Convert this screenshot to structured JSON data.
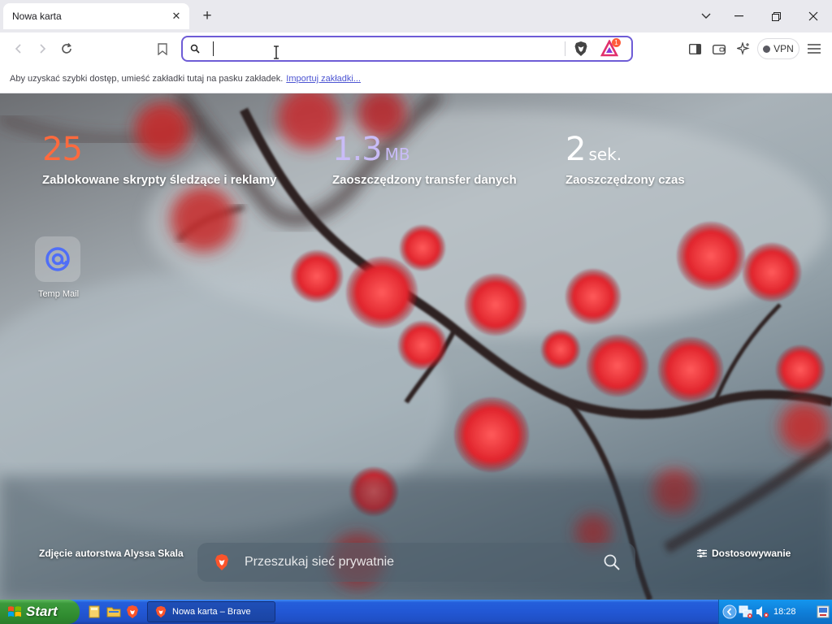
{
  "browser": {
    "tab_title": "Nowa karta",
    "address_value": "",
    "rewards_badge": "1",
    "vpn_label": "VPN"
  },
  "bookmarks_bar": {
    "text": "Aby uzyskać szybki dostęp, umieść zakładki tutaj na pasku zakładek.",
    "import_link": "Importuj zakładki..."
  },
  "stats": [
    {
      "value": "25",
      "unit": "",
      "label": "Zablokowane skrypty śledzące i reklamy",
      "color": "#ff6a3d"
    },
    {
      "value": "1.3",
      "unit": "MB",
      "label": "Zaoszczędzony transfer danych",
      "color": "#c9bcf7"
    },
    {
      "value": "2",
      "unit": "sek.",
      "label": "Zaoszczędzony czas",
      "color": "#ffffff"
    }
  ],
  "top_sites": [
    {
      "label": "Temp Mail"
    }
  ],
  "photo_credit": "Zdjęcie autorstwa Alyssa Skala",
  "search": {
    "placeholder": "Przeszukaj sieć prywatnie"
  },
  "customize_label": "Dostosowywanie",
  "taskbar": {
    "start_label": "Start",
    "task_label": "Nowa karta – Brave",
    "clock": "18:28"
  },
  "colors": {
    "accent": "#6e5cd6",
    "taskbar": "#245edb",
    "start": "#3c9a3c"
  }
}
